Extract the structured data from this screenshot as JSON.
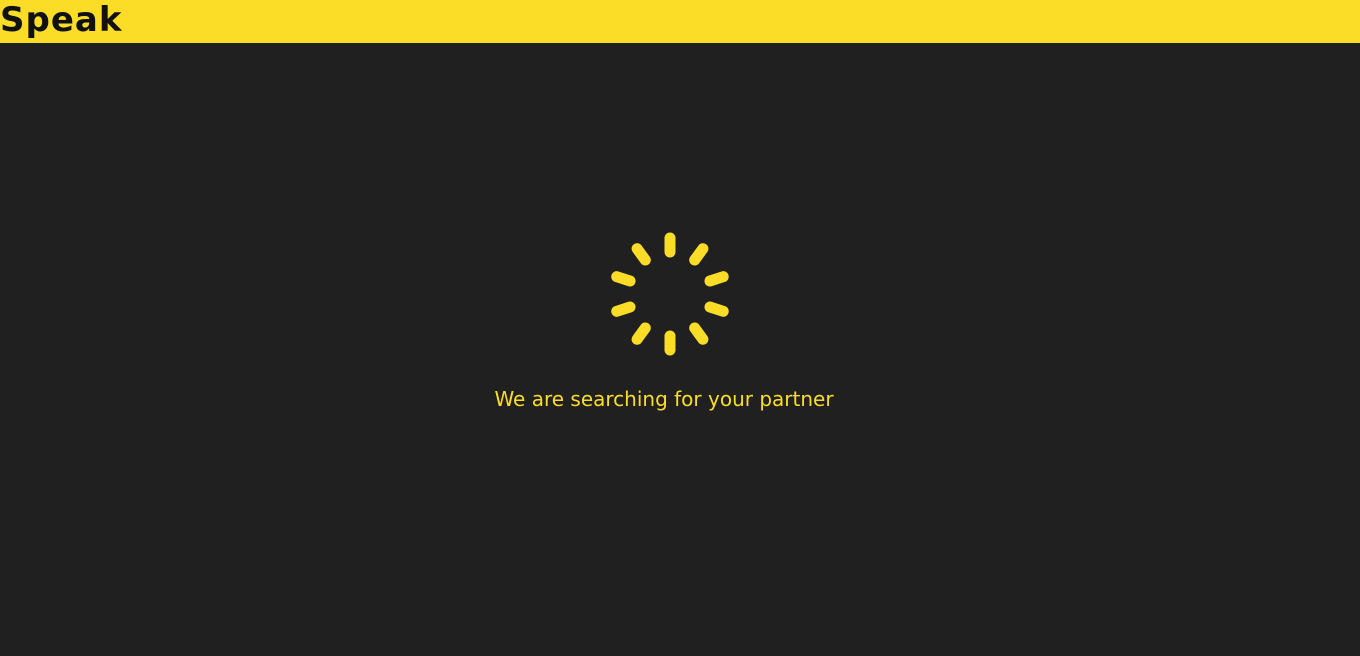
{
  "app": {
    "brand": "Speak"
  },
  "main": {
    "status_text": "We are searching for your partner"
  },
  "spinner": {
    "icon": "loading-spinner-icon",
    "color": "#fbdd27",
    "spokes": 10
  },
  "colors": {
    "header_bg": "#fbdd27",
    "page_bg": "#202020",
    "brand_text": "#111111",
    "accent": "#fbdd27"
  }
}
